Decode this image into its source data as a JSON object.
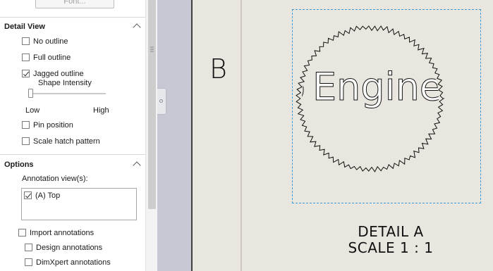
{
  "panel": {
    "font_button": "Font...",
    "detail_view": {
      "title": "Detail View",
      "options": [
        {
          "label": "No outline",
          "checked": false
        },
        {
          "label": "Full outline",
          "checked": false
        },
        {
          "label": "Jagged outline",
          "checked": true
        }
      ],
      "shape_intensity": {
        "label": "Shape Intensity",
        "low_label": "Low",
        "high_label": "High",
        "level": 0.0
      },
      "pin_position": {
        "label": "Pin position",
        "checked": false
      },
      "scale_hatch": {
        "label": "Scale hatch pattern",
        "checked": false
      }
    },
    "options": {
      "title": "Options",
      "annotation_views_label": "Annotation view(s):",
      "annotation_views": [
        {
          "label": "(A) Top",
          "checked": true
        }
      ],
      "import_annotations": {
        "label": "Import annotations",
        "checked": false
      },
      "design_annotations": {
        "label": "Design annotations",
        "checked": false
      },
      "dimxpert_annotations": {
        "label": "DimXpert annotations",
        "checked": false
      }
    }
  },
  "canvas": {
    "zone_label": "B",
    "detail_text": "Engine",
    "detail_caption_line1": "DETAIL A",
    "detail_caption_line2": "SCALE 1 : 1"
  },
  "colors": {
    "canvas_bg": "#e9e6df",
    "splitter": "#c6c9d3",
    "detail_boundary": "#3a9ad9"
  }
}
